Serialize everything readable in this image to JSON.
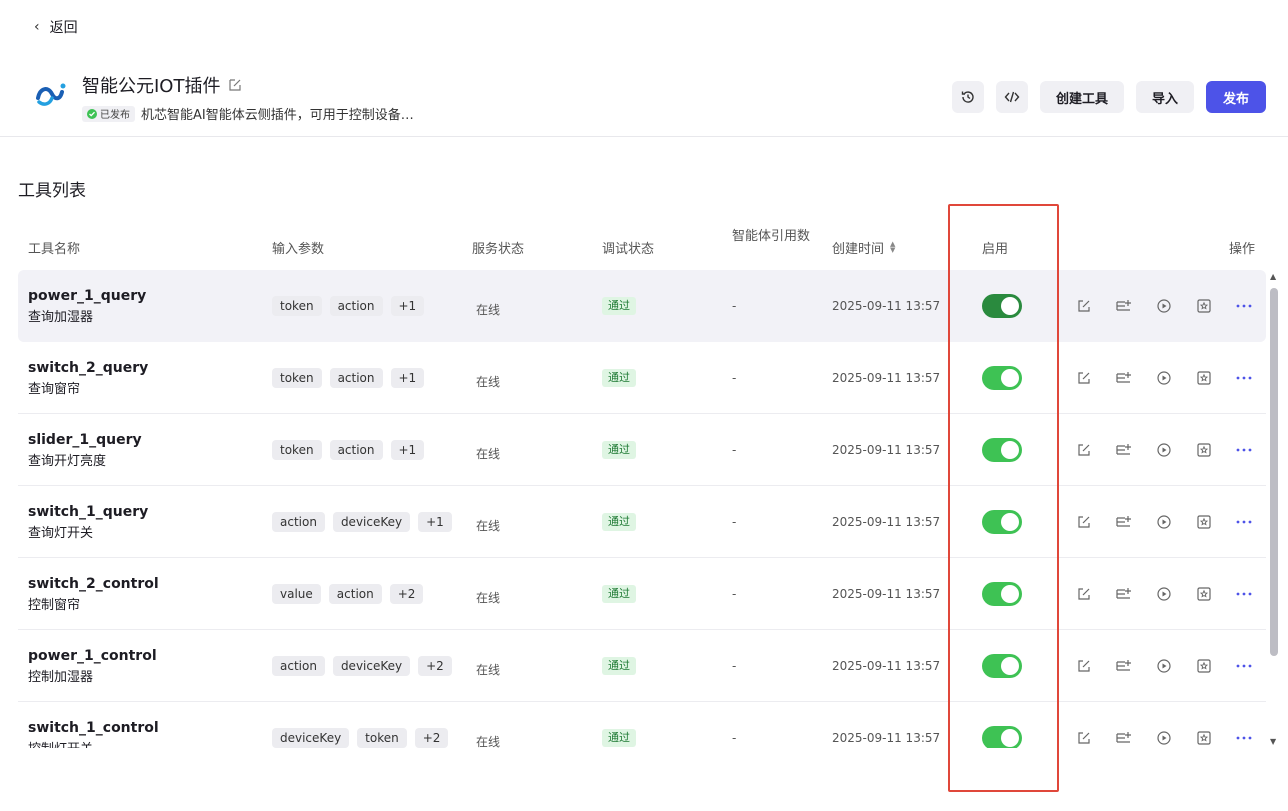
{
  "back": {
    "label": "返回"
  },
  "plugin": {
    "title": "智能公元IOT插件",
    "badge": "已发布",
    "description": "机芯智能AI智能体云侧插件，可用于控制设备…"
  },
  "actions": {
    "create_tool": "创建工具",
    "import": "导入",
    "publish": "发布"
  },
  "section_title": "工具列表",
  "columns": {
    "name": "工具名称",
    "params": "输入参数",
    "service": "服务状态",
    "debug": "调试状态",
    "refs": "智能体引用数",
    "created": "创建时间",
    "enabled": "启用",
    "ops": "操作"
  },
  "rows": [
    {
      "en": "power_1_query",
      "zh": "查询加湿器",
      "tags": [
        "token",
        "action",
        "+1"
      ],
      "service": "在线",
      "debug": "通过",
      "refs": "-",
      "created": "2025-09-11 13:57",
      "enabled": true
    },
    {
      "en": "switch_2_query",
      "zh": "查询窗帘",
      "tags": [
        "token",
        "action",
        "+1"
      ],
      "service": "在线",
      "debug": "通过",
      "refs": "-",
      "created": "2025-09-11 13:57",
      "enabled": true
    },
    {
      "en": "slider_1_query",
      "zh": "查询开灯亮度",
      "tags": [
        "token",
        "action",
        "+1"
      ],
      "service": "在线",
      "debug": "通过",
      "refs": "-",
      "created": "2025-09-11 13:57",
      "enabled": true
    },
    {
      "en": "switch_1_query",
      "zh": "查询灯开关",
      "tags": [
        "action",
        "deviceKey",
        "+1"
      ],
      "service": "在线",
      "debug": "通过",
      "refs": "-",
      "created": "2025-09-11 13:57",
      "enabled": true
    },
    {
      "en": "switch_2_control",
      "zh": "控制窗帘",
      "tags": [
        "value",
        "action",
        "+2"
      ],
      "service": "在线",
      "debug": "通过",
      "refs": "-",
      "created": "2025-09-11 13:57",
      "enabled": true
    },
    {
      "en": "power_1_control",
      "zh": "控制加湿器",
      "tags": [
        "action",
        "deviceKey",
        "+2"
      ],
      "service": "在线",
      "debug": "通过",
      "refs": "-",
      "created": "2025-09-11 13:57",
      "enabled": true
    },
    {
      "en": "switch_1_control",
      "zh": "控制灯开关",
      "tags": [
        "deviceKey",
        "token",
        "+2"
      ],
      "service": "在线",
      "debug": "通过",
      "refs": "-",
      "created": "2025-09-11 13:57",
      "enabled": true
    }
  ],
  "colors": {
    "primary": "#4d53e8",
    "toggle_on": "#3ec254",
    "highlight": "#e0473a"
  }
}
